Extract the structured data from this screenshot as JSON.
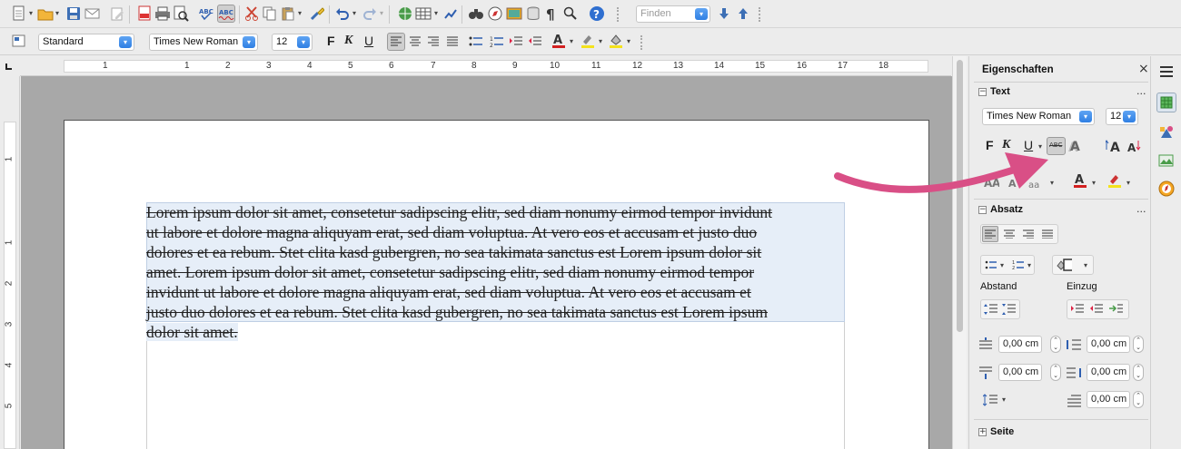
{
  "toolbar_standard": {
    "find_placeholder": "Finden"
  },
  "toolbar_format": {
    "paragraph_style": "Standard",
    "font_name": "Times New Roman",
    "font_size": "12",
    "bold": "F",
    "italic": "K",
    "underline": "U"
  },
  "ruler": {
    "horizontal_ticks": [
      "1",
      "1",
      "2",
      "3",
      "4",
      "5",
      "6",
      "7",
      "8",
      "9",
      "10",
      "11",
      "12",
      "13",
      "14",
      "15",
      "16",
      "17",
      "18"
    ],
    "vertical_ticks": [
      "1",
      "1",
      "2",
      "3",
      "4",
      "5"
    ]
  },
  "document": {
    "lines": [
      "Lorem ipsum dolor sit amet, consetetur sadipscing elitr, sed diam nonumy eirmod tempor invidunt",
      "ut labore et dolore magna aliquyam erat, sed diam voluptua. At vero eos et accusam et justo duo",
      "dolores et ea rebum. Stet clita kasd gubergren, no sea takimata sanctus est Lorem ipsum dolor sit",
      "amet. Lorem ipsum dolor sit amet, consetetur sadipscing elitr, sed diam nonumy eirmod tempor",
      "invidunt ut labore et dolore magna aliquyam erat, sed diam voluptua. At vero eos et accusam et",
      "justo duo dolores et ea rebum. Stet clita kasd gubergren, no sea takimata sanctus est Lorem ipsum",
      "dolor sit amet."
    ]
  },
  "sidebar": {
    "title": "Eigenschaften",
    "close_glyph": "×",
    "text_section": {
      "header": "Text",
      "font_name": "Times New Roman",
      "font_size": "12",
      "bold": "F",
      "italic": "K",
      "underline": "U",
      "strikethrough": "ABC"
    },
    "paragraph_section": {
      "header": "Absatz",
      "spacing_label": "Abstand",
      "indent_label": "Einzug",
      "above_spacing": "0,00 cm",
      "below_spacing": "0,00 cm",
      "before_indent": "0,00 cm",
      "after_indent": "0,00 cm",
      "first_line_indent": "0,00 cm"
    },
    "page_section": {
      "header": "Seite"
    },
    "more_glyph": "..."
  },
  "colors": {
    "accent_blue": "#2f7fe3",
    "annotation_arrow": "#d94f86",
    "selection": "#e6eef8",
    "font_color_red": "#d22020",
    "highlight_yellow": "#f4e21c"
  }
}
